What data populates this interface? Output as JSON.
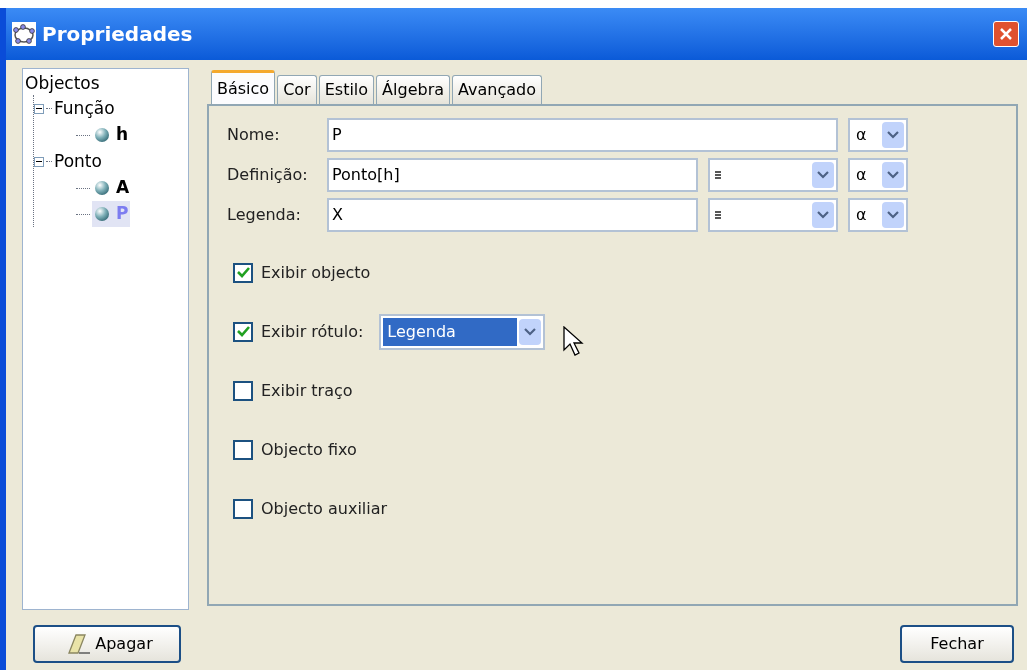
{
  "window": {
    "title": "Propriedades"
  },
  "tree": {
    "label": "Objectos",
    "children": [
      {
        "label": "Função",
        "expanded": true,
        "children": [
          {
            "label": "h",
            "selected": false
          }
        ]
      },
      {
        "label": "Ponto",
        "expanded": true,
        "children": [
          {
            "label": "A",
            "selected": false
          },
          {
            "label": "P",
            "selected": true
          }
        ]
      }
    ]
  },
  "tabs": [
    {
      "label": "Básico",
      "selected": true
    },
    {
      "label": "Cor",
      "selected": false
    },
    {
      "label": "Estilo",
      "selected": false
    },
    {
      "label": "Álgebra",
      "selected": false
    },
    {
      "label": "Avançado",
      "selected": false
    }
  ],
  "fields": [
    {
      "label": "Nome:",
      "value": "P",
      "has_symbol_menu": false,
      "alpha": "α"
    },
    {
      "label": "Definição:",
      "value": "Ponto[h]",
      "has_symbol_menu": true,
      "alpha": "α"
    },
    {
      "label": "Legenda:",
      "value": "X",
      "has_symbol_menu": true,
      "alpha": "α"
    }
  ],
  "checkboxes": [
    {
      "label": "Exibir objecto",
      "checked": true
    },
    {
      "label": "Exibir rótulo:",
      "checked": true,
      "dropdown": "Legenda"
    },
    {
      "label": "Exibir traço",
      "checked": false
    },
    {
      "label": "Objecto fixo",
      "checked": false
    },
    {
      "label": "Objecto auxiliar",
      "checked": false
    }
  ],
  "buttons": {
    "left": "Apagar",
    "right": "Fechar"
  }
}
